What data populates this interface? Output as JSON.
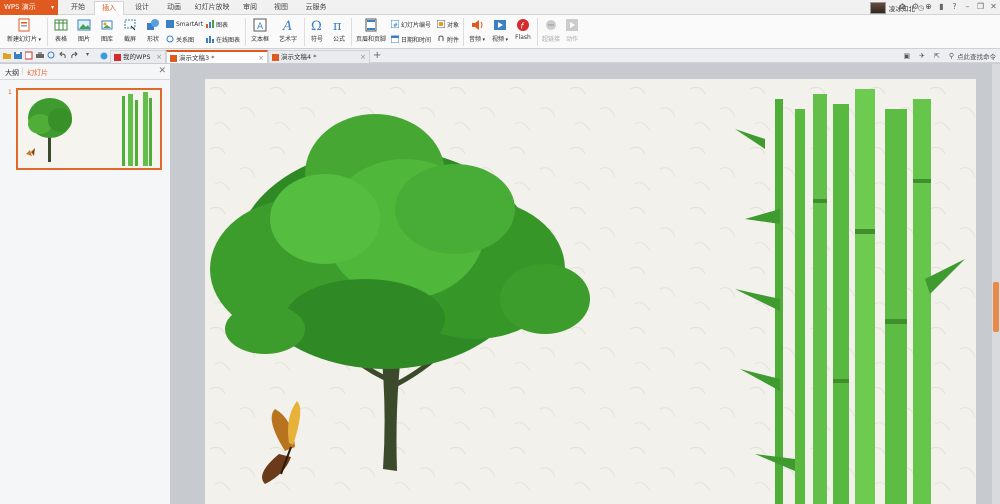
{
  "app": {
    "logo": "WPS 演示"
  },
  "menu": {
    "tabs": [
      "开始",
      "插入",
      "设计",
      "动画",
      "幻灯片放映",
      "审阅",
      "视图",
      "云服务"
    ],
    "active_index": 1
  },
  "user": {
    "name": "凌冰知北"
  },
  "ribbon": {
    "new_slide": "新建幻灯片",
    "table": "表格",
    "picture": "图片",
    "gallery": "图库",
    "screenshot": "截屏",
    "shape": "形状",
    "smartart": "SmartArt",
    "chart": "图表",
    "relation": "关系图",
    "online_chart": "在线图表",
    "textbox": "文本框",
    "wordart": "艺术字",
    "symbol": "符号",
    "formula": "公式",
    "header_footer": "页眉和页脚",
    "slide_number": "幻灯片编号",
    "object": "对象",
    "datetime": "日期和时间",
    "attachment": "附件",
    "audio": "音频",
    "video": "视频",
    "flash": "Flash",
    "hyperlink": "超链接",
    "action": "动作"
  },
  "doc_tabs": [
    {
      "label": "我的WPS",
      "active": false
    },
    {
      "label": "演示文稿3 *",
      "active": true
    },
    {
      "label": "演示文稿4 *",
      "active": false
    }
  ],
  "search_help": "点此查找命令",
  "left_panel": {
    "tabs": [
      "大纲",
      "幻灯片"
    ],
    "active_index": 1,
    "slide_number": "1"
  },
  "colors": {
    "accent": "#e05a1f",
    "slide_bg": "#f3f1ec"
  }
}
